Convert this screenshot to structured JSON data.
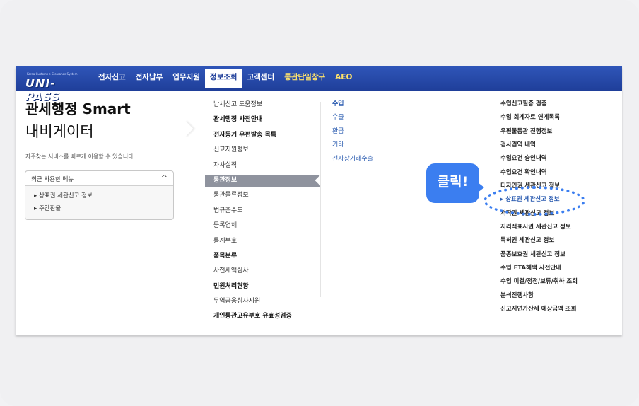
{
  "logo": {
    "small": "Korea Customs e-Clearance System",
    "main": "UNI-PASS"
  },
  "nav": [
    "전자신고",
    "전자납부",
    "업무지원",
    "정보조회",
    "고객센터",
    "통관단일창구",
    "AEO"
  ],
  "left": {
    "title1": "관세행정 Smart",
    "title2": "내비게이터",
    "subtitle": "자주찾는 서비스를 빠르게 이용할 수 있습니다.",
    "recent_title": "최근 사용한 메뉴",
    "recent_caret": "^",
    "recent_items": [
      "▸ 상표권 세관신고 정보",
      "▸ 주간환율"
    ]
  },
  "col1": [
    "납세신고 도움정보",
    "관세행정 사전안내",
    "전자등기 우편발송 목록",
    "신고지원정보",
    "자사실적",
    "통관정보",
    "통관물류정보",
    "법규준수도",
    "등록업체",
    "통계부호",
    "품목분류",
    "사전세액심사",
    "민원처리현황",
    "무역금융심사지원",
    "개인통관고유부호 유효성검증"
  ],
  "col2": [
    "수입",
    "수출",
    "환급",
    "기타",
    "전자상거래수출"
  ],
  "col3": [
    "수입신고필증 검증",
    "수입 회계자료 연계목록",
    "우편물통관 진행정보",
    "검사검역 내역",
    "수입요건 승인내역",
    "수입요건 확인내역",
    "디자인권 세관신고 정보",
    "▸ 상표권 세관신고 정보",
    "저작권 세관신고 정보",
    "지리적표시권 세관신고 정보",
    "특허권 세관신고 정보",
    "품종보호권 세관신고 정보",
    "수입 FTA혜택 사전안내",
    "수입 미결/정정/보류/취하 조회",
    "분석진행사항",
    "신고지연가산세 예상금액 조회"
  ],
  "annotation": {
    "bubble": "클릭!"
  },
  "colors": {
    "topbar": "#2f55b8",
    "accent": "#3b7ef0",
    "link": "#2a5bb0"
  }
}
